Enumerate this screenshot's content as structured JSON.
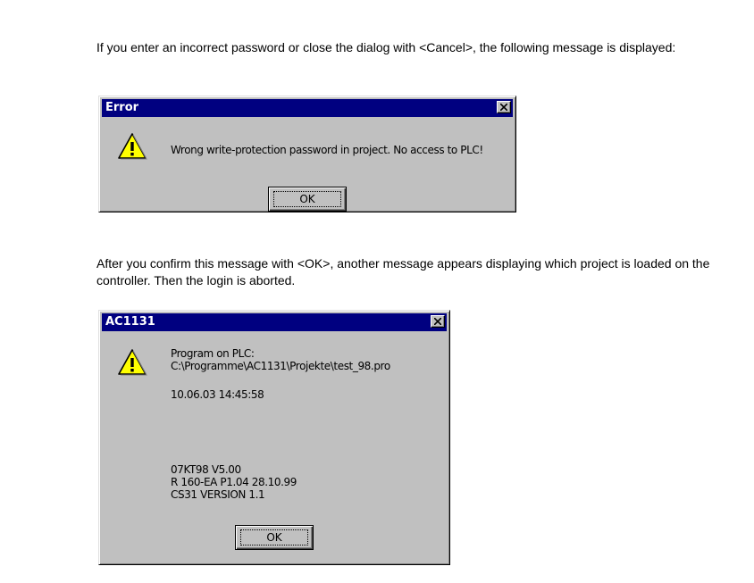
{
  "paragraph1": "If you enter an incorrect password or close the dialog with <Cancel>, the following message is displayed:",
  "paragraph2": "After you confirm this message with <OK>, another message appears displaying which project is loaded on the controller. Then the login is aborted.",
  "dialog_error": {
    "title": "Error",
    "message": "Wrong write-protection password in project. No access to PLC!",
    "ok_label": "OK",
    "icon": "warning-icon"
  },
  "dialog_ac1131": {
    "title": "AC1131",
    "line1": "Program on PLC:",
    "line2": "C:\\Programme\\AC1131\\Projekte\\test_98.pro",
    "timestamp": "10.06.03 14:45:58",
    "info1": "07KT98 V5.00",
    "info2": "R 160-EA P1.04 28.10.99",
    "info3": "CS31 VERSION 1.1",
    "ok_label": "OK",
    "icon": "warning-icon"
  },
  "colors": {
    "titlebar": "#000080",
    "dialog_face": "#c0c0c0",
    "warning_fill": "#ffff00"
  }
}
